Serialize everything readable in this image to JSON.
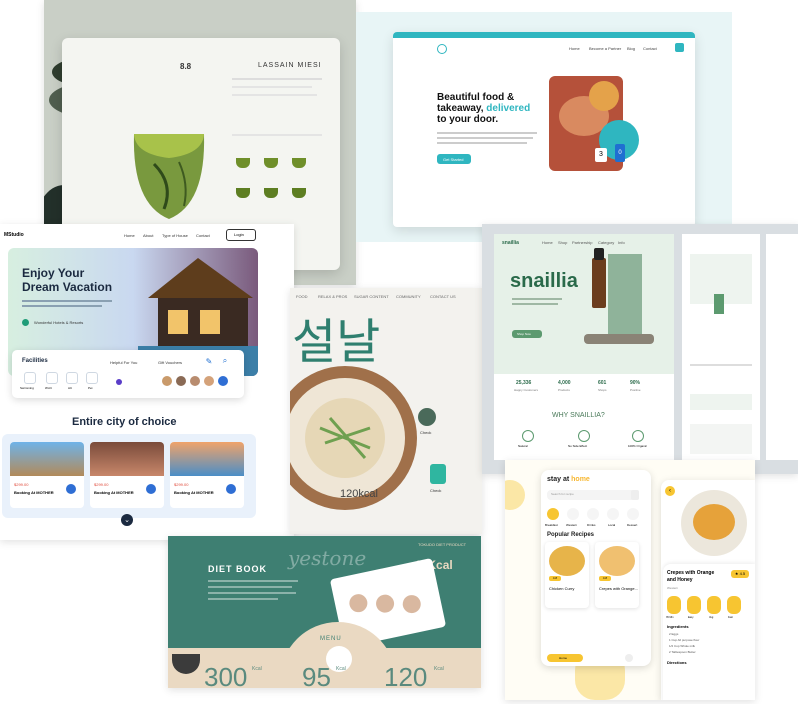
{
  "tea": {
    "title": "LASSAIN MIESI",
    "size_label": "8.8",
    "icons": [
      "cup-icon",
      "cup-icon",
      "cup-icon",
      "cup-icon",
      "cup-icon",
      "cup-icon"
    ]
  },
  "food": {
    "headline_1": "Beautiful food &",
    "headline_2": "takeaway,",
    "headline_accent": "delivered",
    "headline_3": "to your door.",
    "cta": "Get Started",
    "nav": [
      "Home",
      "Become a Partner",
      "Blog",
      "Contact"
    ],
    "accent": "#2fb6c0",
    "badge_3": "3",
    "badge_0": "0"
  },
  "vacation": {
    "brand": "MStudio",
    "nav": [
      "Home",
      "About",
      "Type of House",
      "Contact"
    ],
    "login": "Login",
    "hero_title_1": "Enjoy Your",
    "hero_title_2": "Dream Vacation",
    "hero_sub": "Wonderful Hotels & Resorts",
    "facilities_label": "Facilities",
    "facilities_col2": "Helpful For You",
    "facilities_col3": "Gift Vouchers",
    "fac_items": [
      "Swimming",
      "Wi-Fi",
      "AC",
      "Pet"
    ],
    "section_title": "Entire city of choice",
    "cards": [
      {
        "price": "$299.00",
        "name": "Booking At MOTHER"
      },
      {
        "price": "$299.00",
        "name": "Booking At MOTHER"
      },
      {
        "price": "$299.00",
        "name": "Booking At MOTHER"
      }
    ]
  },
  "korean": {
    "nav": [
      "FOOD",
      "RELAX & PROS",
      "SUGAR CONTENT",
      "COMMUNITY",
      "CONTACT US"
    ],
    "korean_title": "설날",
    "kcal": "120kcal",
    "chat_1": "Check",
    "chat_2": "Check"
  },
  "snaillia": {
    "brand": "snaillia",
    "nav": [
      "Home",
      "Shop",
      "Partnership",
      "Category",
      "Info"
    ],
    "stats": [
      {
        "value": "25,336",
        "label": "Happy Customers"
      },
      {
        "value": "4,000",
        "label": "Products"
      },
      {
        "value": "601",
        "label": "Shops"
      },
      {
        "value": "90%",
        "label": "Positive"
      }
    ],
    "why_title": "WHY SNAILLIA?",
    "why_items": [
      "Natural",
      "No Side Effect",
      "100% Organic"
    ],
    "cta": "Shop Now"
  },
  "diet": {
    "title": "DIET BOOK",
    "brand": "yestone",
    "kcal_top": "45Kcal",
    "sub": "TOKUDO DIET PRODUCT",
    "menu": "MENU",
    "stats": [
      {
        "value": "300",
        "unit": "Kcal"
      },
      {
        "value": "95",
        "unit": "Kcal"
      },
      {
        "value": "120",
        "unit": "Kcal"
      }
    ]
  },
  "recipe": {
    "title_1": "stay at",
    "title_accent": "home",
    "search_placeholder": "Search for recipe",
    "categories": [
      "Breakfast",
      "Western",
      "Drinks",
      "Local",
      "Dessert"
    ],
    "popular": "Popular Recipes",
    "cards": [
      {
        "name": "Chicken Curry",
        "rating": "4.8"
      },
      {
        "name": "Crepes with Orange...",
        "rating": "4.8"
      }
    ],
    "detail_title_1": "Crepes with Orange",
    "detail_title_2": "and Honey",
    "detail_sub": "Western",
    "detail_rating": "4.5",
    "stats": [
      "35 Min",
      "Easy",
      "Veg",
      "Fast"
    ],
    "ingredients": "Ingredients",
    "ingredient_items": [
      "2 Eggs",
      "1 Cup All purpose flour",
      "1/2 Cup Whole milk",
      "2 Tablespoon Butter"
    ],
    "directions": "Directions",
    "home_btn": "Home",
    "accent": "#f7c531"
  }
}
